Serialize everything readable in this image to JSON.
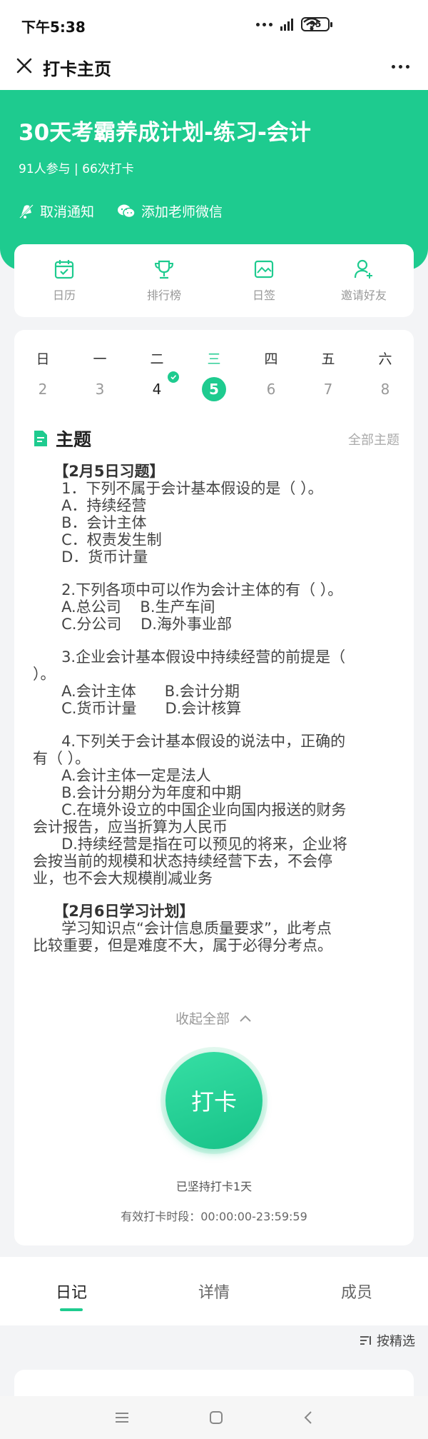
{
  "status": {
    "time": "下午5:38",
    "battery": "95"
  },
  "nav": {
    "title": "打卡主页"
  },
  "hero": {
    "title": "30天考霸养成计划-练习-会计",
    "stats": "91人参与  |  66次打卡",
    "actions": [
      {
        "label": "取消通知",
        "icon": "bell-off-icon"
      },
      {
        "label": "添加老师微信",
        "icon": "wechat-icon"
      }
    ]
  },
  "tools": [
    {
      "label": "日历",
      "icon": "calendar-icon"
    },
    {
      "label": "排行榜",
      "icon": "trophy-icon"
    },
    {
      "label": "日签",
      "icon": "image-icon"
    },
    {
      "label": "邀请好友",
      "icon": "invite-user-icon"
    }
  ],
  "week": {
    "days": [
      {
        "name": "日",
        "num": "2",
        "state": "none"
      },
      {
        "name": "一",
        "num": "3",
        "state": "none"
      },
      {
        "name": "二",
        "num": "4",
        "state": "done"
      },
      {
        "name": "三",
        "num": "5",
        "state": "today"
      },
      {
        "name": "四",
        "num": "6",
        "state": "none"
      },
      {
        "name": "五",
        "num": "7",
        "state": "none"
      },
      {
        "name": "六",
        "num": "8",
        "state": "none"
      }
    ]
  },
  "topic": {
    "title": "主题",
    "all_label": "全部主题",
    "lines": [
      {
        "text": "    【2月5日习题】",
        "bold": true
      },
      {
        "text": "      1．下列不属于会计基本假设的是（ ）。"
      },
      {
        "text": "      A．持续经营"
      },
      {
        "text": "      B．会计主体"
      },
      {
        "text": "      C．权责发生制"
      },
      {
        "text": "      D．货币计量"
      },
      {
        "gap": true
      },
      {
        "text": "      2.下列各项中可以作为会计主体的有（ ）。"
      },
      {
        "text": "      A.总公司    B.生产车间"
      },
      {
        "text": "      C.分公司    D.海外事业部"
      },
      {
        "gap": true
      },
      {
        "text": "      3.企业会计基本假设中持续经营的前提是（"
      },
      {
        "text": "）。"
      },
      {
        "text": "      A.会计主体      B.会计分期"
      },
      {
        "text": "      C.货币计量      D.会计核算"
      },
      {
        "gap": true
      },
      {
        "text": "      4.下列关于会计基本假设的说法中，正确的"
      },
      {
        "text": "有（ ）。"
      },
      {
        "text": "      A.会计主体一定是法人"
      },
      {
        "text": "      B.会计分期分为年度和中期"
      },
      {
        "text": "      C.在境外设立的中国企业向国内报送的财务"
      },
      {
        "text": "会计报告，应当折算为人民币"
      },
      {
        "text": "      D.持续经营是指在可以预见的将来，企业将"
      },
      {
        "text": "会按当前的规模和状态持续经营下去，不会停"
      },
      {
        "text": "业，也不会大规模削减业务"
      },
      {
        "gap": true
      },
      {
        "text": "    【2月6日学习计划】",
        "bold": true
      },
      {
        "text": "      学习知识点“会计信息质量要求”，此考点"
      },
      {
        "text": "比较重要，但是难度不大，属于必得分考点。"
      }
    ],
    "collapse_label": "收起全部"
  },
  "checkin": {
    "button_label": "打卡",
    "streak": "已坚持打卡1天",
    "period": "有效打卡时段：00:00:00-23:59:59"
  },
  "tabs": [
    {
      "label": "日记",
      "active": true
    },
    {
      "label": "详情",
      "active": false
    },
    {
      "label": "成员",
      "active": false
    }
  ],
  "filter": {
    "label": "按精选"
  },
  "colors": {
    "accent": "#1ecb8f"
  }
}
